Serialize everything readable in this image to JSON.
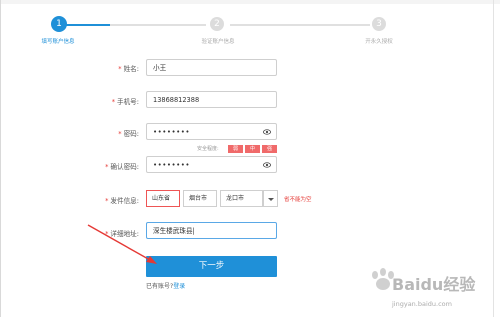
{
  "steps": [
    {
      "number": "1",
      "label": "填写账户信息",
      "state": "active"
    },
    {
      "number": "2",
      "label": "验证账户信息",
      "state": "inactive"
    },
    {
      "number": "3",
      "label": "开永久授权",
      "state": "inactive"
    }
  ],
  "form": {
    "required_mark": "*",
    "name": {
      "label": "姓名:",
      "value": "小王"
    },
    "phone": {
      "label": "手机号:",
      "value": "13868812388"
    },
    "password": {
      "label": "密码:",
      "value": "••••••••"
    },
    "strength": {
      "label": "安全程度:",
      "levels": [
        "弱",
        "中",
        "强"
      ]
    },
    "confirm_password": {
      "label": "确认密码:",
      "value": "••••••••"
    },
    "shipping": {
      "label": "发件信息:",
      "province": "山东省",
      "city": "烟台市",
      "district": "龙口市",
      "error": "省不能为空"
    },
    "address": {
      "label": "详细地址:",
      "value": "深生楼武珠县|"
    }
  },
  "next_button": {
    "label": "下一步"
  },
  "login_prompt": {
    "text": "已有账号?",
    "link": "登录"
  },
  "watermark": {
    "brand": "Baidu经验",
    "url": "jingyan.baidu.com"
  },
  "colors": {
    "accent": "#1f90d8",
    "error": "#e53935",
    "strength": "#f06a6a",
    "annotation_arrow": "#e53935"
  }
}
